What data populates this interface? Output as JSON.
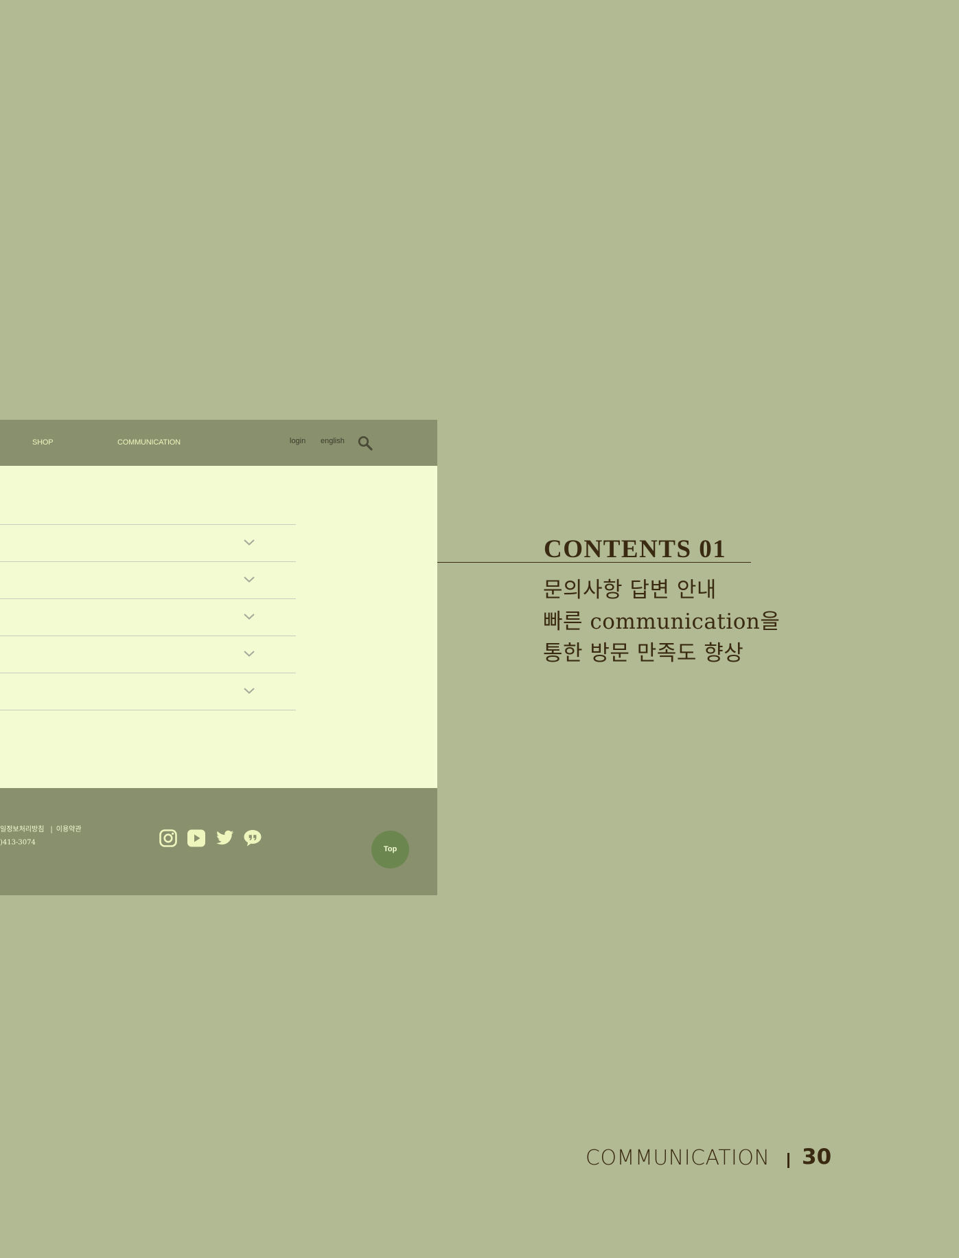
{
  "mockup": {
    "header": {
      "nav": [
        {
          "label": "SHOP"
        },
        {
          "label": "COMMUNICATION"
        }
      ],
      "login_label": "login",
      "english_label": "english"
    },
    "faq_item_count": 5,
    "footer": {
      "privacy_link": "일정보처리방침",
      "separator": "|",
      "terms_link": "이용약관",
      "phone": ")413-3074",
      "social_icons": [
        "instagram-icon",
        "youtube-icon",
        "twitter-icon",
        "kakaotalk-icon"
      ],
      "top_label": "Top"
    }
  },
  "contents": {
    "title": "CONTENTS 01",
    "lines": [
      "문의사항 답변 안내",
      "빠른 communication을",
      "통한 방문 만족도 향상"
    ]
  },
  "page": {
    "section": "COMMUNICATION",
    "number": "30"
  },
  "colors": {
    "background": "#b1ba92",
    "mockup_bar": "#89906d",
    "mockup_content": "#f3fbd3",
    "accent_text": "#eef5bd",
    "top_button": "#6c8650",
    "heading_text": "#3b2a12"
  }
}
